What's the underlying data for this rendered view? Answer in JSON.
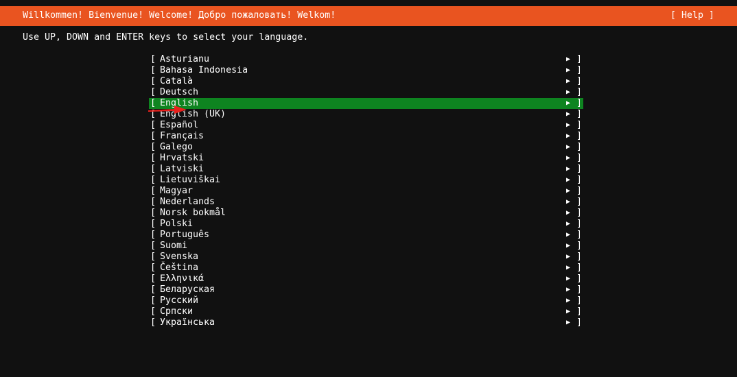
{
  "header": {
    "title": "Willkommen! Bienvenue! Welcome! Добро пожаловать! Welkom!",
    "help_label": "[ Help ]",
    "color": "#e95420"
  },
  "instruction": "Use UP, DOWN and ENTER keys to select your language.",
  "list": {
    "open_bracket": "[",
    "close_bracket": "]",
    "arrow_glyph": "▶",
    "selected_index": 4,
    "selected_color": "#0e8420",
    "items": [
      {
        "label": "Asturianu"
      },
      {
        "label": "Bahasa Indonesia"
      },
      {
        "label": "Català"
      },
      {
        "label": "Deutsch"
      },
      {
        "label": "English"
      },
      {
        "label": "English (UK)"
      },
      {
        "label": "Español"
      },
      {
        "label": "Français"
      },
      {
        "label": "Galego"
      },
      {
        "label": "Hrvatski"
      },
      {
        "label": "Latviski"
      },
      {
        "label": "Lietuviškai"
      },
      {
        "label": "Magyar"
      },
      {
        "label": "Nederlands"
      },
      {
        "label": "Norsk bokmål"
      },
      {
        "label": "Polski"
      },
      {
        "label": "Português"
      },
      {
        "label": "Suomi"
      },
      {
        "label": "Svenska"
      },
      {
        "label": "Čeština"
      },
      {
        "label": "Ελληνικά"
      },
      {
        "label": "Беларуская"
      },
      {
        "label": "Русский"
      },
      {
        "label": "Српски"
      },
      {
        "label": "Українська"
      }
    ]
  },
  "annotation": {
    "icon": "red-arrow-icon",
    "color": "#e8201c"
  }
}
